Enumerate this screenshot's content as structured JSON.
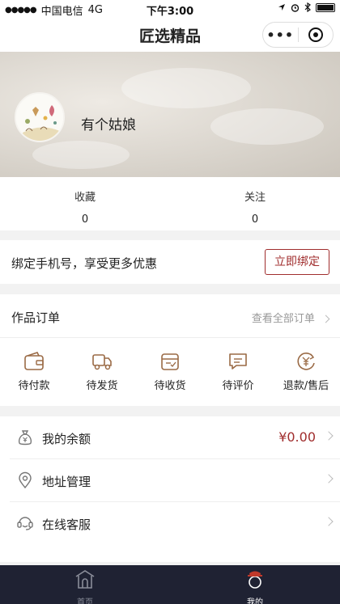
{
  "status_bar": {
    "signal": "●●●●●",
    "carrier": "中国电信",
    "network": "4G",
    "time": "下午3:00"
  },
  "navbar": {
    "title": "匠选精品",
    "more_icon": "more-dots-icon",
    "close_icon": "target-icon"
  },
  "profile": {
    "username": "有个姑娘",
    "avatar_icon": "avatar-image"
  },
  "stats": [
    {
      "label": "收藏",
      "value": "0"
    },
    {
      "label": "关注",
      "value": "0"
    }
  ],
  "bind_phone": {
    "text": "绑定手机号，享受更多优惠",
    "button": "立即绑定"
  },
  "orders": {
    "title": "作品订单",
    "view_all": "查看全部订单",
    "items": [
      {
        "label": "待付款",
        "icon": "wallet-icon"
      },
      {
        "label": "待发货",
        "icon": "truck-icon"
      },
      {
        "label": "待收货",
        "icon": "box-icon"
      },
      {
        "label": "待评价",
        "icon": "comment-icon"
      },
      {
        "label": "退款/售后",
        "icon": "refund-icon"
      }
    ]
  },
  "menu": [
    {
      "label": "我的余额",
      "value": "¥0.00",
      "icon": "money-bag-icon"
    },
    {
      "label": "地址管理",
      "value": "",
      "icon": "location-icon"
    },
    {
      "label": "在线客服",
      "value": "",
      "icon": "service-icon"
    }
  ],
  "tabbar": [
    {
      "label": "首页",
      "icon": "home-icon",
      "active": false
    },
    {
      "label": "我的",
      "icon": "profile-icon",
      "active": true
    }
  ],
  "colors": {
    "accent": "#a02d2d",
    "icon_brown": "#9a6a45",
    "tabbar_bg": "#1f2233"
  }
}
